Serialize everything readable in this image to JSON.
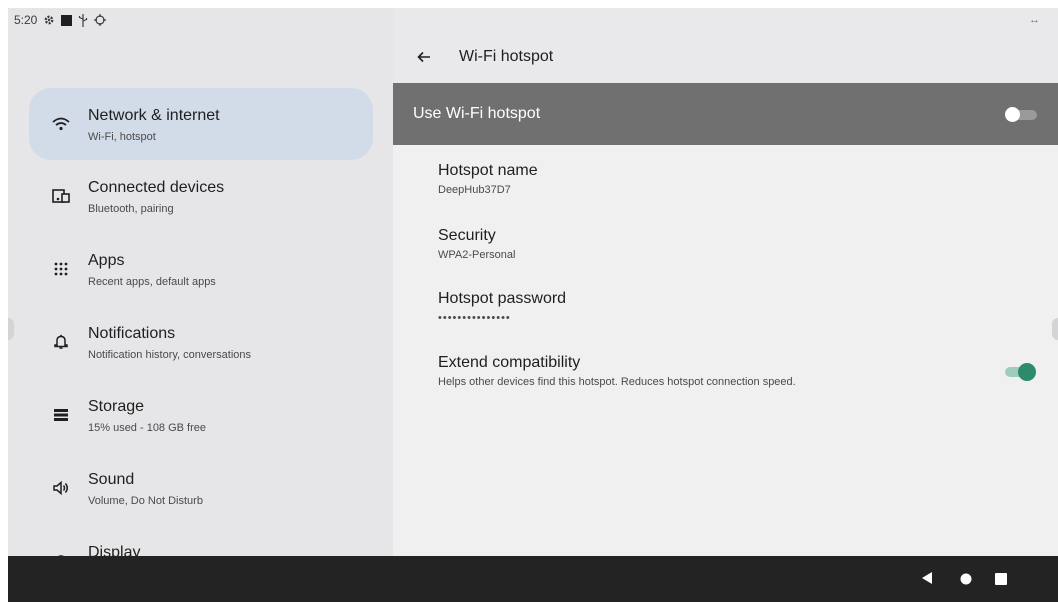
{
  "status_bar": {
    "time": "5:20",
    "icons": [
      "settings-gear-icon",
      "black-square-icon",
      "usb-icon",
      "location-target-icon"
    ]
  },
  "sidebar": {
    "items": [
      {
        "title": "Network & internet",
        "subtitle": "Wi-Fi, hotspot",
        "icon": "wifi-icon",
        "active": true
      },
      {
        "title": "Connected devices",
        "subtitle": "Bluetooth, pairing",
        "icon": "devices-icon",
        "active": false
      },
      {
        "title": "Apps",
        "subtitle": "Recent apps, default apps",
        "icon": "apps-grid-icon",
        "active": false
      },
      {
        "title": "Notifications",
        "subtitle": "Notification history, conversations",
        "icon": "bell-icon",
        "active": false
      },
      {
        "title": "Storage",
        "subtitle": "15% used - 108 GB free",
        "icon": "storage-icon",
        "active": false
      },
      {
        "title": "Sound",
        "subtitle": "Volume, Do Not Disturb",
        "icon": "speaker-icon",
        "active": false
      },
      {
        "title": "Display",
        "subtitle": "",
        "icon": "display-icon",
        "active": false
      }
    ]
  },
  "detail": {
    "expand_glyph": "↔",
    "title": "Wi-Fi hotspot",
    "use_hotspot": {
      "label": "Use Wi-Fi hotspot",
      "enabled": false
    },
    "settings": [
      {
        "title": "Hotspot name",
        "value": "DeepHub37D7"
      },
      {
        "title": "Security",
        "value": "WPA2-Personal"
      },
      {
        "title": "Hotspot password",
        "value": "•••••••••••••••"
      },
      {
        "title": "Extend compatibility",
        "value": "Helps other devices find this hotspot. Reduces hotspot connection speed.",
        "enabled": true
      }
    ]
  },
  "colors": {
    "active_item_bg": "#d2dbe8",
    "hotspot_bar_bg": "#707070",
    "switch_on": "#2e8a6c",
    "navbar_bg": "#232323"
  },
  "nav_bar": {
    "buttons": [
      "back-triangle-icon",
      "home-circle-icon",
      "recents-square-icon"
    ]
  }
}
